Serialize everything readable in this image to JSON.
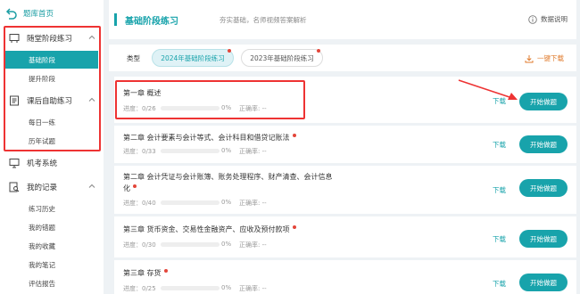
{
  "sidebar": {
    "home": "题库首页",
    "groups": [
      {
        "label": "随堂阶段练习",
        "items": [
          "基础阶段",
          "提升阶段"
        ]
      },
      {
        "label": "课后自助练习",
        "items": [
          "每日一练",
          "历年试题"
        ]
      },
      {
        "label": "机考系统",
        "items": []
      },
      {
        "label": "我的记录",
        "items": [
          "练习历史",
          "我的错题",
          "我的收藏",
          "我的笔记",
          "评估报告"
        ]
      }
    ]
  },
  "header": {
    "title": "基础阶段练习",
    "subtitle": "夯实基础，名师视频答案解析",
    "note": "数据说明"
  },
  "filter": {
    "type_label": "类型",
    "tabs": [
      "2024年基础阶段练习",
      "2023年基础阶段练习"
    ],
    "download_all": "一键下载"
  },
  "chapters": [
    {
      "title": "第一章 概述",
      "progress_label": "进度：0/26",
      "progress": 0,
      "pct": "0%",
      "accuracy": "正确率: --",
      "dot": false
    },
    {
      "title": "第二章 会计要素与会计等式、会计科目和借贷记账法",
      "progress_label": "进度：0/33",
      "progress": 0,
      "pct": "0%",
      "accuracy": "正确率: --",
      "dot": true
    },
    {
      "title": "第二章 会计凭证与会计账簿、账务处理程序、财产清查、会计信息化",
      "progress_label": "进度：0/40",
      "progress": 0,
      "pct": "0%",
      "accuracy": "正确率: --",
      "dot": true
    },
    {
      "title": "第三章 货币资金、交易性金融资产、应收及预付款项",
      "progress_label": "进度：0/30",
      "progress": 0,
      "pct": "0%",
      "accuracy": "正确率: --",
      "dot": true
    },
    {
      "title": "第三章 存货",
      "progress_label": "进度：0/25",
      "progress": 0,
      "pct": "0%",
      "accuracy": "正确率: --",
      "dot": true
    }
  ],
  "actions": {
    "download": "下载",
    "start": "开始做题"
  },
  "colors": {
    "accent": "#18a3ab",
    "annotation": "#e33333",
    "warning": "#e07b2d"
  }
}
